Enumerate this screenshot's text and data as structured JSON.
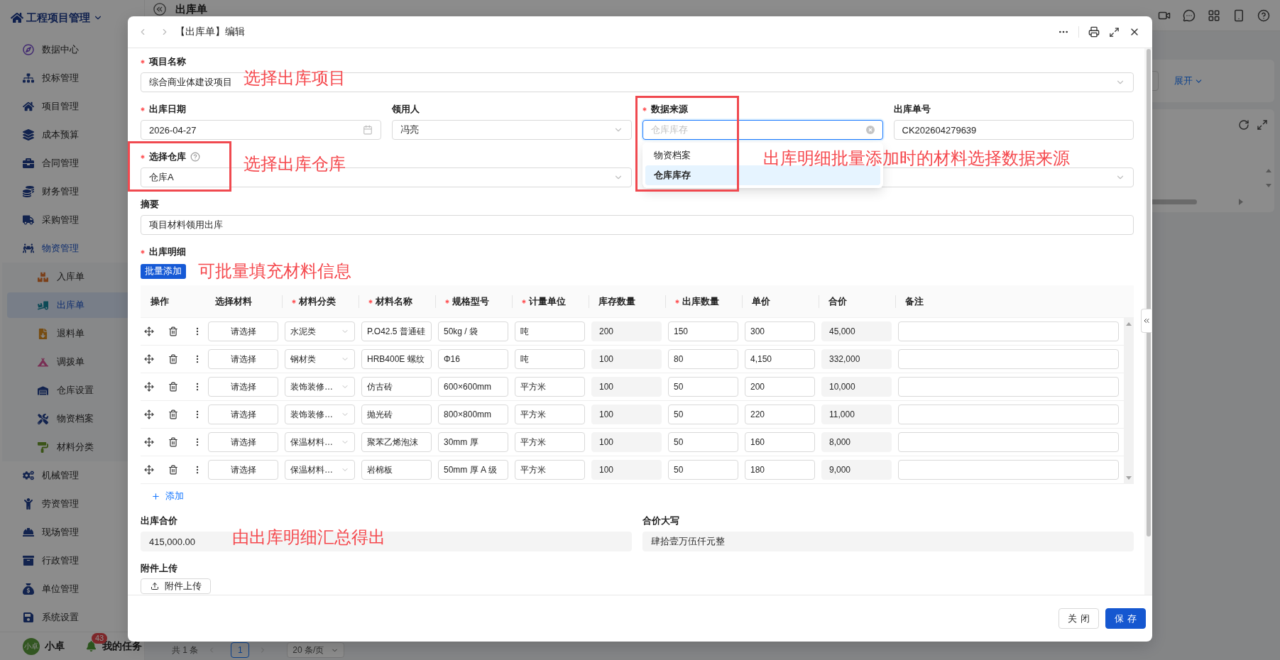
{
  "app": {
    "title": "工程项目管理",
    "menu": [
      {
        "label": "数据中心",
        "selected": false,
        "expanded": false
      },
      {
        "label": "投标管理",
        "selected": false,
        "expanded": false
      },
      {
        "label": "项目管理",
        "selected": false,
        "expanded": false
      },
      {
        "label": "成本预算",
        "selected": false,
        "expanded": false
      },
      {
        "label": "合同管理",
        "selected": false,
        "expanded": false
      },
      {
        "label": "财务管理",
        "selected": false,
        "expanded": false
      },
      {
        "label": "采购管理",
        "selected": false,
        "expanded": false
      },
      {
        "label": "物资管理",
        "selected": false,
        "expanded": true,
        "children": [
          {
            "label": "入库单",
            "selected": false
          },
          {
            "label": "出库单",
            "selected": true
          },
          {
            "label": "退料单",
            "selected": false
          },
          {
            "label": "调拨单",
            "selected": false
          },
          {
            "label": "仓库设置",
            "selected": false
          },
          {
            "label": "物资档案",
            "selected": false
          },
          {
            "label": "材料分类",
            "selected": false
          }
        ]
      },
      {
        "label": "机械管理",
        "selected": false,
        "expanded": false
      },
      {
        "label": "劳资管理",
        "selected": false,
        "expanded": false
      },
      {
        "label": "现场管理",
        "selected": false,
        "expanded": false
      },
      {
        "label": "行政管理",
        "selected": false,
        "expanded": false
      },
      {
        "label": "单位管理",
        "selected": false,
        "expanded": false
      },
      {
        "label": "系统设置",
        "selected": false,
        "expanded": false
      }
    ],
    "user": {
      "avatar_text": "小卓",
      "name": "小卓"
    },
    "tasks": {
      "label": "我的任务",
      "badge": "43"
    }
  },
  "page": {
    "title": "出库单",
    "expand_link": "展开",
    "pagination": {
      "total": "共 1 条",
      "current_page": "1",
      "page_size": "20 条/页"
    }
  },
  "dialog": {
    "title": "【出库单】编辑",
    "fields": [
      [
        {
          "label": "项目名称",
          "required": true,
          "help": false,
          "kind": "select",
          "value": "综合商业体建设项目",
          "open": false,
          "marked": false,
          "note": "选择出库项目"
        }
      ],
      [
        {
          "label": "出库日期",
          "required": true,
          "help": false,
          "kind": "date",
          "value": "2026-04-27",
          "marked": false
        },
        {
          "label": "领用人",
          "required": false,
          "help": false,
          "kind": "select",
          "value": "冯亮",
          "open": false,
          "marked": false
        },
        {
          "label": "数据来源",
          "required": true,
          "help": false,
          "kind": "select",
          "value": "仓库库存",
          "open": true,
          "marked": true,
          "note": "出库明细批量添加时的材料选择数据来源",
          "options": [
            {
              "label": "物资档案",
              "selected": false
            },
            {
              "label": "仓库库存",
              "selected": true
            }
          ]
        },
        {
          "label": "出库单号",
          "required": false,
          "help": false,
          "kind": "text",
          "value": "CK202604279639",
          "marked": false
        }
      ],
      [
        {
          "label": "选择仓库",
          "required": true,
          "help": true,
          "kind": "select",
          "value": "仓库A",
          "open": false,
          "marked": true,
          "note": "选择出库仓库"
        },
        {
          "kind": "select",
          "open": false,
          "marked": false
        }
      ],
      [
        {
          "label": "摘要",
          "required": false,
          "help": false,
          "kind": "text",
          "value": "项目材料领用出库",
          "marked": false
        }
      ]
    ],
    "details": {
      "label": "出库明细",
      "required": true,
      "batch_button": "批量添加",
      "note": "可批量填充材料信息",
      "columns": [
        {
          "label": "操作",
          "required": false,
          "kind": "actions"
        },
        {
          "label": "选择材料",
          "required": false,
          "kind": "button"
        },
        {
          "label": "材料分类",
          "required": true,
          "kind": "select"
        },
        {
          "label": "材料名称",
          "required": true,
          "kind": "input"
        },
        {
          "label": "规格型号",
          "required": true,
          "kind": "input"
        },
        {
          "label": "计量单位",
          "required": true,
          "kind": "input"
        },
        {
          "label": "库存数量",
          "required": false,
          "kind": "readonly"
        },
        {
          "label": "出库数量",
          "required": true,
          "kind": "input"
        },
        {
          "label": "单价",
          "required": false,
          "kind": "input"
        },
        {
          "label": "合价",
          "required": false,
          "kind": "readonly"
        },
        {
          "label": "备注",
          "required": false,
          "kind": "input"
        }
      ],
      "rows": [
        {
          "cells": [
            "",
            "请选择",
            "水泥类",
            "P.O42.5 普通硅",
            "50kg / 袋",
            "吨",
            "200",
            "150",
            "300",
            "45,000"
          ]
        },
        {
          "cells": [
            "",
            "请选择",
            "钢材类",
            "HRB400E 螺纹",
            "Φ16",
            "吨",
            "100",
            "80",
            "4,150",
            "332,000"
          ]
        },
        {
          "cells": [
            "",
            "请选择",
            "装饰装修…",
            "仿古砖",
            "600×600mm",
            "平方米",
            "100",
            "50",
            "200",
            "10,000"
          ]
        },
        {
          "cells": [
            "",
            "请选择",
            "装饰装修…",
            "抛光砖",
            "800×800mm",
            "平方米",
            "100",
            "50",
            "220",
            "11,000"
          ]
        },
        {
          "cells": [
            "",
            "请选择",
            "保温材料…",
            "聚苯乙烯泡沫",
            "30mm 厚",
            "平方米",
            "100",
            "50",
            "160",
            "8,000"
          ]
        },
        {
          "cells": [
            "",
            "请选择",
            "保温材料…",
            "岩棉板",
            "50mm 厚 A 级",
            "平方米",
            "100",
            "50",
            "180",
            "9,000"
          ]
        }
      ],
      "add_link": "添加"
    },
    "totals": [
      {
        "label": "出库合价",
        "required": false,
        "help": false,
        "kind": "readonly",
        "value": "415,000.00",
        "marked": false,
        "note": "由出库明细汇总得出"
      },
      {
        "label": "合价大写",
        "required": false,
        "help": false,
        "kind": "readonly",
        "value": "肆拾壹万伍仟元整",
        "marked": false
      }
    ],
    "attachment": {
      "label": "附件上传",
      "button": "附件上传"
    },
    "buttons": [
      {
        "label": "关闭",
        "kind": "default"
      },
      {
        "label": "保存",
        "kind": "primary"
      }
    ]
  }
}
